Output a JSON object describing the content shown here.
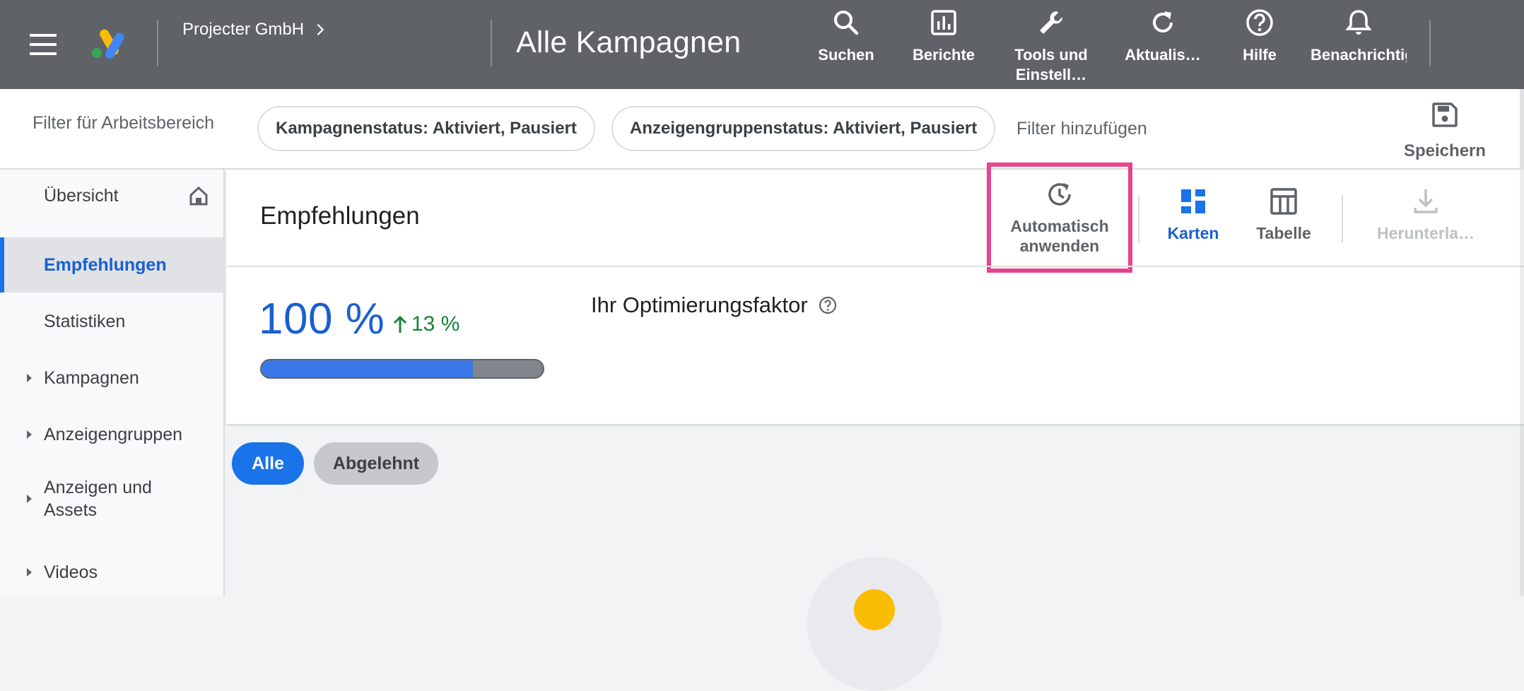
{
  "topbar": {
    "account_name": "Projecter GmbH",
    "page_title": "Alle Kampagnen",
    "actions": [
      {
        "label": "Suchen",
        "icon": "search-icon"
      },
      {
        "label": "Berichte",
        "icon": "reports-icon"
      },
      {
        "label": "Tools und Einstell…",
        "icon": "wrench-icon"
      },
      {
        "label": "Aktualis…",
        "icon": "refresh-icon"
      },
      {
        "label": "Hilfe",
        "icon": "help-icon"
      },
      {
        "label": "Benachrichtigungen",
        "icon": "bell-icon"
      }
    ]
  },
  "filters": {
    "label": "Filter für Arbeitsbereich",
    "chips": [
      "Kampagnenstatus: Aktiviert, Pausiert",
      "Anzeigengruppenstatus: Aktiviert, Pausiert"
    ],
    "add_filter": "Filter hinzufügen",
    "save_label": "Speichern"
  },
  "sidebar": {
    "items": [
      {
        "label": "Übersicht"
      },
      {
        "label": "Empfehlungen"
      },
      {
        "label": "Statistiken"
      },
      {
        "label": "Kampagnen"
      },
      {
        "label": "Anzeigengruppen"
      },
      {
        "label": "Anzeigen und Assets"
      },
      {
        "label": "Videos"
      }
    ]
  },
  "main": {
    "title": "Empfehlungen",
    "actions": {
      "auto_apply": "Automatisch anwenden",
      "cards": "Karten",
      "table": "Tabelle",
      "download": "Herunterla…"
    },
    "score": "100 %",
    "score_delta": "13 %",
    "progress_fraction": 0.75,
    "optimization_label": "Ihr Optimierungsfaktor"
  },
  "tabs": {
    "all": "Alle",
    "rejected": "Abgelehnt"
  },
  "colors": {
    "topbar": "#5f6368",
    "accent": "#1a73e8",
    "highlight": "#e8448d",
    "positive": "#188038"
  }
}
